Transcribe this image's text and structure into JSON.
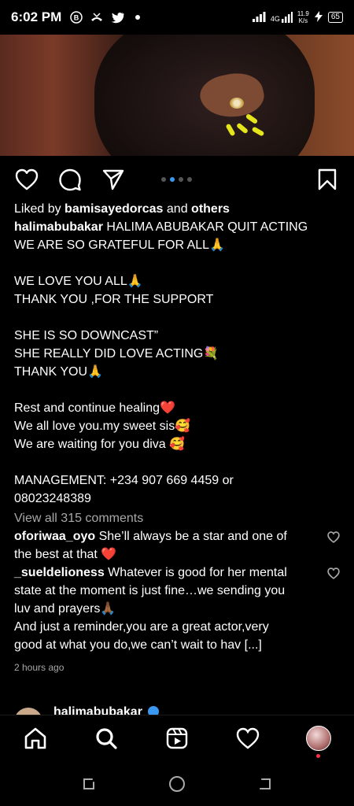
{
  "status_bar": {
    "time": "6:02 PM",
    "net_label": "4G",
    "speed_value": "11.9",
    "speed_unit": "K/s",
    "battery": "65",
    "icons": [
      "b-app-icon",
      "missed-call-icon",
      "twitter-icon",
      "notification-dot-icon",
      "signal-icon",
      "signal-4g-icon",
      "charging-icon",
      "battery-icon"
    ]
  },
  "post": {
    "carousel": {
      "count": 4,
      "active_index": 1
    },
    "liked_by_prefix": "Liked by ",
    "liked_by_user": "bamisayedorcas",
    "liked_by_and": " and ",
    "liked_by_others": "others",
    "author": "halimabubakar",
    "caption_first": " HALIMA ABUBAKAR QUIT ACTING",
    "caption_lines": [
      "WE ARE SO GRATEFUL FOR ALL🙏",
      "",
      "WE LOVE YOU ALL🙏",
      "THANK YOU ,FOR THE SUPPORT",
      "",
      "SHE IS SO DOWNCAST”",
      "SHE REALLY DID LOVE ACTING💐",
      "THANK YOU🙏",
      "",
      "Rest and continue healing❤️",
      "We all love you.my sweet sis🥰",
      "We are waiting for you diva 🥰",
      "",
      "MANAGEMENT: +234 907 669 4459 or",
      "08023248389"
    ],
    "view_comments": "View all 315 comments",
    "comments": [
      {
        "user": "oforiwaa_oyo",
        "text": " She’ll always be a star and one of",
        "text2": "the best at that ❤️"
      },
      {
        "user": "_sueldelioness",
        "text": " Whatever is good for her mental",
        "text2": "state at the moment is just fine…we sending you",
        "text3": "luv and prayers🙏🏾",
        "text4": "And just a reminder,you are a great actor,very",
        "text5": "good at what you do,we can’t wait to hav [...]"
      }
    ],
    "timestamp": "2 hours ago"
  },
  "next_post": {
    "user": "halimabubakar"
  },
  "nav": [
    "home-icon",
    "search-icon",
    "reels-icon",
    "activity-heart-icon",
    "profile-avatar"
  ],
  "colors": {
    "accent_blue": "#3b98f0",
    "like_red": "#ff3040",
    "muted": "#a8a8a8",
    "nail_yellow": "#e5e51c"
  }
}
